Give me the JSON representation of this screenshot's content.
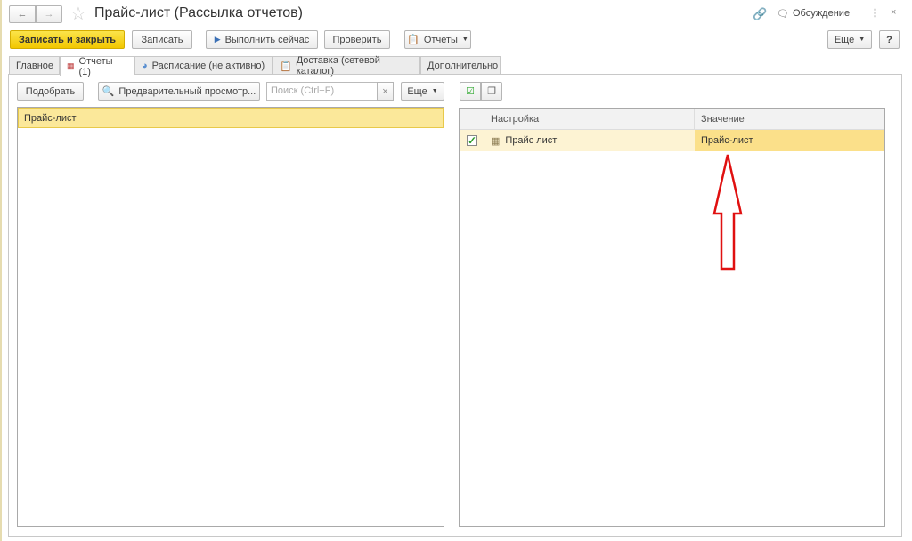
{
  "window": {
    "title": "Прайс-лист (Рассылка отчетов)",
    "discussion": "Обсуждение"
  },
  "toolbar": {
    "save_close": "Записать и закрыть",
    "save": "Записать",
    "run_now": "Выполнить сейчас",
    "check": "Проверить",
    "reports": "Отчеты",
    "more": "Еще",
    "help": "?"
  },
  "tabs": [
    "Главное",
    "Отчеты (1)",
    "Расписание (не активно)",
    "Доставка (сетевой каталог)",
    "Дополнительно"
  ],
  "left": {
    "pick": "Подобрать",
    "preview": "Предварительный просмотр...",
    "search_placeholder": "Поиск (Ctrl+F)",
    "clear": "×",
    "more": "Еще",
    "rows": [
      "Прайс-лист"
    ]
  },
  "right": {
    "columns": [
      "Настройка",
      "Значение"
    ],
    "rows": [
      {
        "checked": true,
        "setting": "Прайс лист",
        "value": "Прайс-лист"
      }
    ]
  },
  "colors": {
    "accent": "#f2c700",
    "selected_row": "#fbe89a",
    "annotation": "#e01010"
  }
}
